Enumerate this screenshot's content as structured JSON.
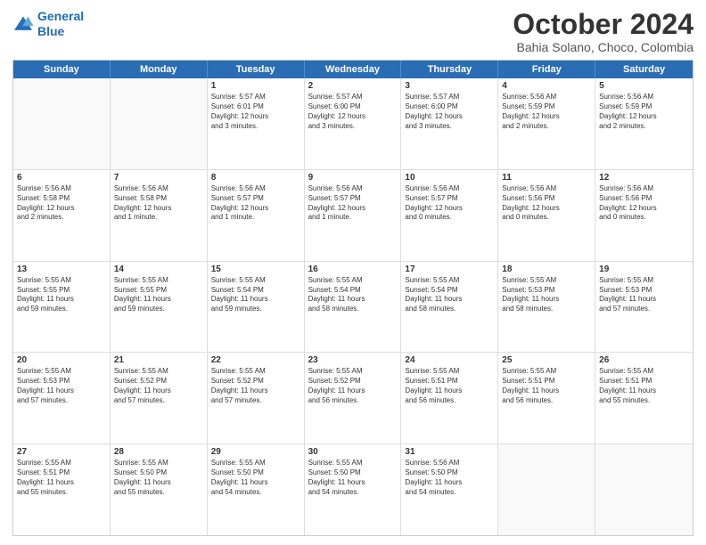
{
  "logo": {
    "line1": "General",
    "line2": "Blue"
  },
  "title": "October 2024",
  "subtitle": "Bahia Solano, Choco, Colombia",
  "weekdays": [
    "Sunday",
    "Monday",
    "Tuesday",
    "Wednesday",
    "Thursday",
    "Friday",
    "Saturday"
  ],
  "weeks": [
    [
      {
        "day": "",
        "text": ""
      },
      {
        "day": "",
        "text": ""
      },
      {
        "day": "1",
        "text": "Sunrise: 5:57 AM\nSunset: 6:01 PM\nDaylight: 12 hours\nand 3 minutes."
      },
      {
        "day": "2",
        "text": "Sunrise: 5:57 AM\nSunset: 6:00 PM\nDaylight: 12 hours\nand 3 minutes."
      },
      {
        "day": "3",
        "text": "Sunrise: 5:57 AM\nSunset: 6:00 PM\nDaylight: 12 hours\nand 3 minutes."
      },
      {
        "day": "4",
        "text": "Sunrise: 5:56 AM\nSunset: 5:59 PM\nDaylight: 12 hours\nand 2 minutes."
      },
      {
        "day": "5",
        "text": "Sunrise: 5:56 AM\nSunset: 5:59 PM\nDaylight: 12 hours\nand 2 minutes."
      }
    ],
    [
      {
        "day": "6",
        "text": "Sunrise: 5:56 AM\nSunset: 5:58 PM\nDaylight: 12 hours\nand 2 minutes."
      },
      {
        "day": "7",
        "text": "Sunrise: 5:56 AM\nSunset: 5:58 PM\nDaylight: 12 hours\nand 1 minute."
      },
      {
        "day": "8",
        "text": "Sunrise: 5:56 AM\nSunset: 5:57 PM\nDaylight: 12 hours\nand 1 minute."
      },
      {
        "day": "9",
        "text": "Sunrise: 5:56 AM\nSunset: 5:57 PM\nDaylight: 12 hours\nand 1 minute."
      },
      {
        "day": "10",
        "text": "Sunrise: 5:56 AM\nSunset: 5:57 PM\nDaylight: 12 hours\nand 0 minutes."
      },
      {
        "day": "11",
        "text": "Sunrise: 5:56 AM\nSunset: 5:56 PM\nDaylight: 12 hours\nand 0 minutes."
      },
      {
        "day": "12",
        "text": "Sunrise: 5:56 AM\nSunset: 5:56 PM\nDaylight: 12 hours\nand 0 minutes."
      }
    ],
    [
      {
        "day": "13",
        "text": "Sunrise: 5:55 AM\nSunset: 5:55 PM\nDaylight: 11 hours\nand 59 minutes."
      },
      {
        "day": "14",
        "text": "Sunrise: 5:55 AM\nSunset: 5:55 PM\nDaylight: 11 hours\nand 59 minutes."
      },
      {
        "day": "15",
        "text": "Sunrise: 5:55 AM\nSunset: 5:54 PM\nDaylight: 11 hours\nand 59 minutes."
      },
      {
        "day": "16",
        "text": "Sunrise: 5:55 AM\nSunset: 5:54 PM\nDaylight: 11 hours\nand 58 minutes."
      },
      {
        "day": "17",
        "text": "Sunrise: 5:55 AM\nSunset: 5:54 PM\nDaylight: 11 hours\nand 58 minutes."
      },
      {
        "day": "18",
        "text": "Sunrise: 5:55 AM\nSunset: 5:53 PM\nDaylight: 11 hours\nand 58 minutes."
      },
      {
        "day": "19",
        "text": "Sunrise: 5:55 AM\nSunset: 5:53 PM\nDaylight: 11 hours\nand 57 minutes."
      }
    ],
    [
      {
        "day": "20",
        "text": "Sunrise: 5:55 AM\nSunset: 5:53 PM\nDaylight: 11 hours\nand 57 minutes."
      },
      {
        "day": "21",
        "text": "Sunrise: 5:55 AM\nSunset: 5:52 PM\nDaylight: 11 hours\nand 57 minutes."
      },
      {
        "day": "22",
        "text": "Sunrise: 5:55 AM\nSunset: 5:52 PM\nDaylight: 11 hours\nand 57 minutes."
      },
      {
        "day": "23",
        "text": "Sunrise: 5:55 AM\nSunset: 5:52 PM\nDaylight: 11 hours\nand 56 minutes."
      },
      {
        "day": "24",
        "text": "Sunrise: 5:55 AM\nSunset: 5:51 PM\nDaylight: 11 hours\nand 56 minutes."
      },
      {
        "day": "25",
        "text": "Sunrise: 5:55 AM\nSunset: 5:51 PM\nDaylight: 11 hours\nand 56 minutes."
      },
      {
        "day": "26",
        "text": "Sunrise: 5:55 AM\nSunset: 5:51 PM\nDaylight: 11 hours\nand 55 minutes."
      }
    ],
    [
      {
        "day": "27",
        "text": "Sunrise: 5:55 AM\nSunset: 5:51 PM\nDaylight: 11 hours\nand 55 minutes."
      },
      {
        "day": "28",
        "text": "Sunrise: 5:55 AM\nSunset: 5:50 PM\nDaylight: 11 hours\nand 55 minutes."
      },
      {
        "day": "29",
        "text": "Sunrise: 5:55 AM\nSunset: 5:50 PM\nDaylight: 11 hours\nand 54 minutes."
      },
      {
        "day": "30",
        "text": "Sunrise: 5:55 AM\nSunset: 5:50 PM\nDaylight: 11 hours\nand 54 minutes."
      },
      {
        "day": "31",
        "text": "Sunrise: 5:56 AM\nSunset: 5:50 PM\nDaylight: 11 hours\nand 54 minutes."
      },
      {
        "day": "",
        "text": ""
      },
      {
        "day": "",
        "text": ""
      }
    ]
  ]
}
